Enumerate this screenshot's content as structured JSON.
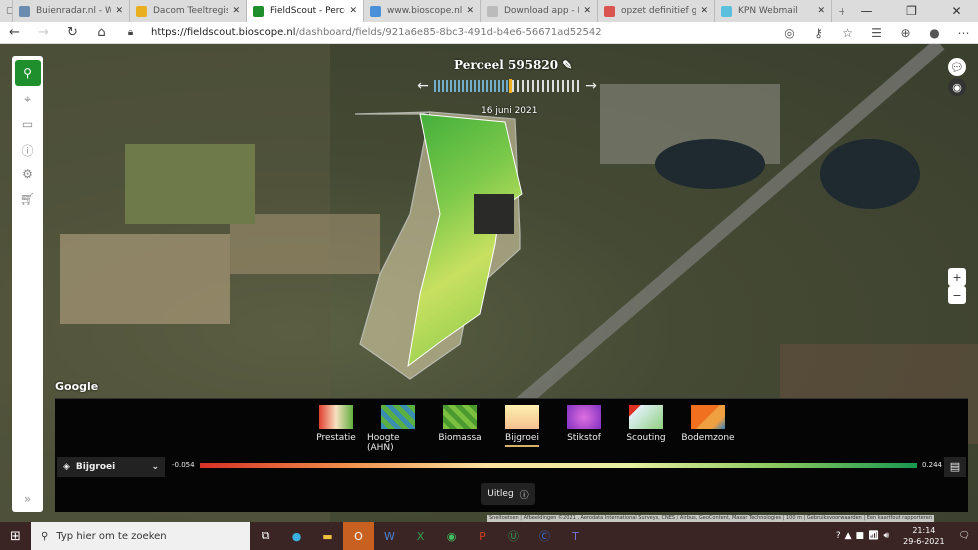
{
  "browser": {
    "tabs": [
      {
        "title": "Buienradar.nl - Weer",
        "color": "#6a8caf",
        "active": false
      },
      {
        "title": "Dacom Teeltregistratie",
        "color": "#e8b020",
        "active": false
      },
      {
        "title": "FieldScout - Percelen",
        "color": "#1f8f2e",
        "active": true
      },
      {
        "title": "www.bioscope.nl - Bio",
        "color": "#4a90d9",
        "active": false
      },
      {
        "title": "Download app - Bio",
        "color": "#bbb",
        "active": false
      },
      {
        "title": "opzet definitief groei",
        "color": "#d9534f",
        "active": false
      },
      {
        "title": "KPN Webmail",
        "color": "#5bc0de",
        "active": false
      }
    ],
    "url_domain": "https://fieldscout.bioscope.nl",
    "url_path": "/dashboard/fields/921a6e85-8bc3-491d-b4e6-56671ad52542"
  },
  "field": {
    "title": "Perceel 595820",
    "date": "16 juni 2021"
  },
  "map": {
    "provider": "Google",
    "attribution": "Sneltoetsen | Afbeeldingen ©2021 , Aerodata International Surveys, CNES / Airbus, GeoContent, Maxar Technologies | 100 m | Gebruiksvoorwaarden | Een kaartfout rapporteren",
    "zoom_in": "+",
    "zoom_out": "−"
  },
  "layers": {
    "items": [
      {
        "label": "Prestatie",
        "thumb": "linear-gradient(90deg,#e04030,#f8e0c0,#60b040)"
      },
      {
        "label": "Hoogte (AHN)",
        "thumb": "repeating-linear-gradient(45deg,#3a8fb0 0 5px,#5cb040 5px 10px)"
      },
      {
        "label": "Biomassa",
        "thumb": "repeating-linear-gradient(45deg,#7cc040 0 5px,#4a9a30 5px 10px)"
      },
      {
        "label": "Bijgroei",
        "thumb": "linear-gradient(180deg,#fdf0b0,#f5c090)",
        "selected": true
      },
      {
        "label": "Stikstof",
        "thumb": "radial-gradient(circle,#e070e0,#8030c0)"
      },
      {
        "label": "Scouting",
        "thumb": "linear-gradient(135deg,#e03020 0 20%,#e0f0f8 20%,#90d080)"
      },
      {
        "label": "Bodemzone",
        "thumb": "linear-gradient(135deg,#f07020 0 50%,#f0a040 50% 75%,#3080c0)"
      }
    ],
    "active_layer": "Bijgroei",
    "scale_min": "-0.054",
    "scale_max": "0.244",
    "explain": "Uitleg"
  },
  "taskbar": {
    "search_placeholder": "Typ hier om te zoeken",
    "time": "21:14",
    "date": "29-6-2021"
  }
}
